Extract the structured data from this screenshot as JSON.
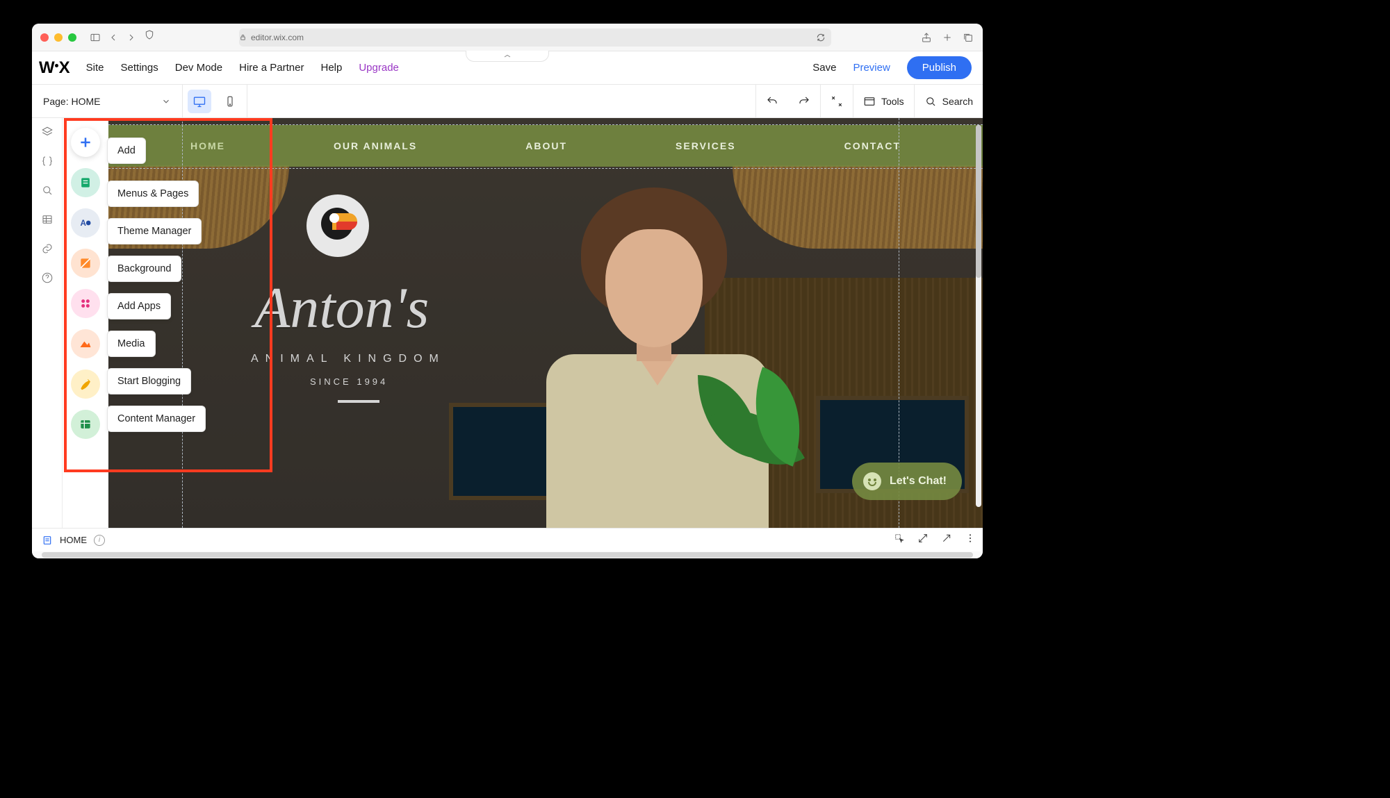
{
  "browser": {
    "url": "editor.wix.com"
  },
  "wix_menu": {
    "items": [
      "Site",
      "Settings",
      "Dev Mode",
      "Hire a Partner",
      "Help"
    ],
    "upgrade": "Upgrade",
    "save": "Save",
    "preview": "Preview",
    "publish": "Publish"
  },
  "toolbar": {
    "page_label_prefix": "Page:",
    "page_name": "HOME",
    "tools": "Tools",
    "search": "Search"
  },
  "tool_panel": {
    "labels": {
      "add": "Add",
      "menus_pages": "Menus & Pages",
      "theme_manager": "Theme Manager",
      "background": "Background",
      "add_apps": "Add Apps",
      "media": "Media",
      "start_blogging": "Start Blogging",
      "content_manager": "Content Manager"
    }
  },
  "site": {
    "nav": [
      "HOME",
      "OUR ANIMALS",
      "ABOUT",
      "SERVICES",
      "CONTACT"
    ],
    "hero_title": "Anton's",
    "hero_sub": "ANIMAL KINGDOM",
    "hero_since": "SINCE 1994",
    "chat": "Let's Chat!"
  },
  "bottom": {
    "page": "HOME"
  }
}
